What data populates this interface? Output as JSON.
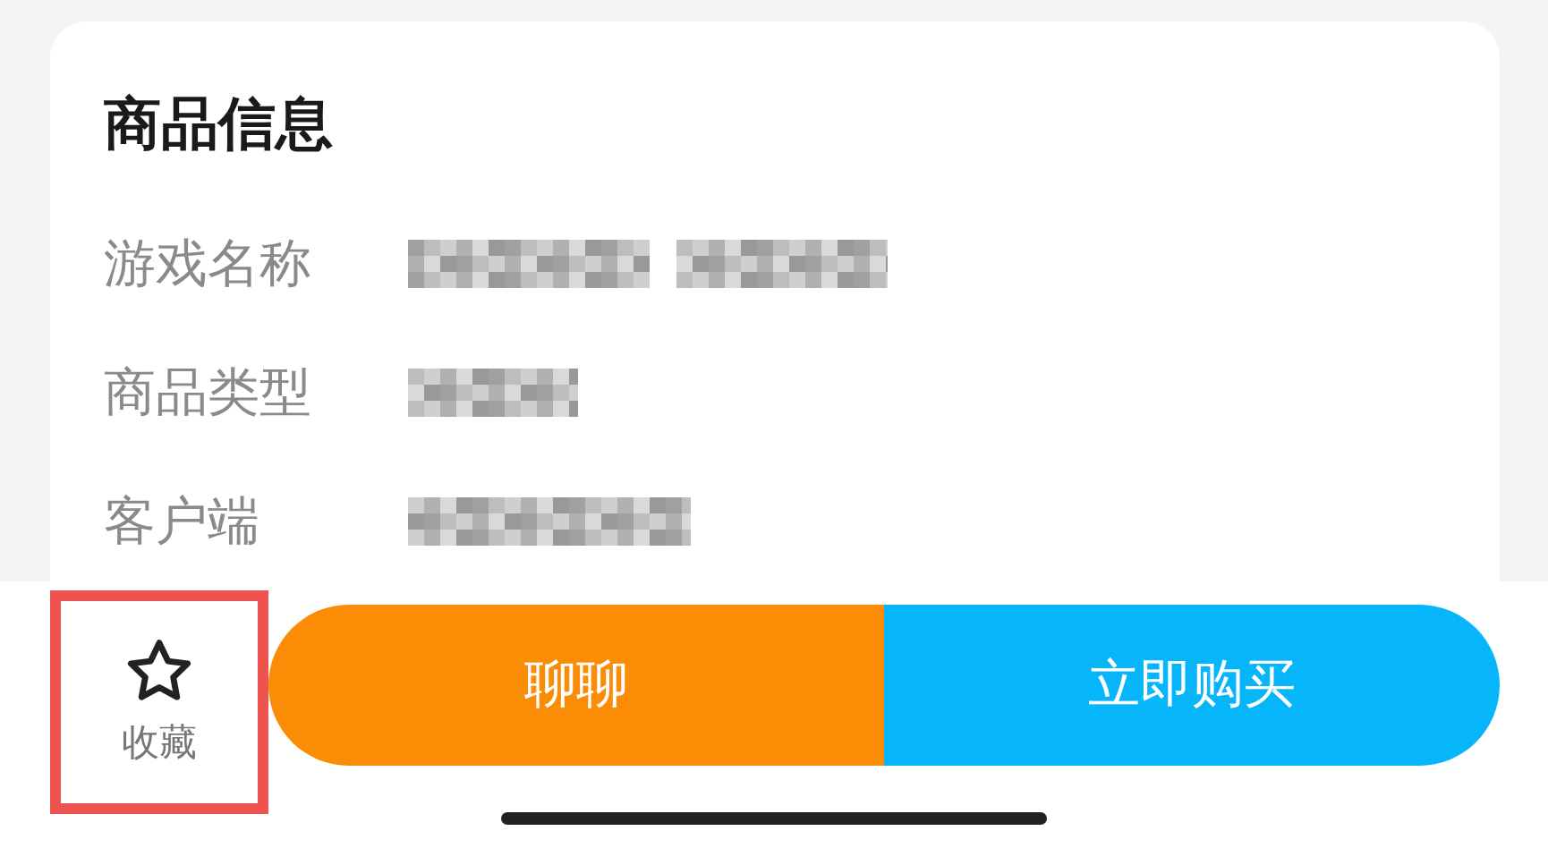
{
  "section": {
    "title": "商品信息",
    "fields": [
      {
        "label": "游戏名称"
      },
      {
        "label": "商品类型"
      },
      {
        "label": "客户端"
      }
    ]
  },
  "bottom_bar": {
    "favorite": {
      "label": "收藏",
      "highlighted": true
    },
    "buttons": [
      {
        "label": "聊聊",
        "kind": "chat"
      },
      {
        "label": "立即购买",
        "kind": "buy"
      }
    ]
  }
}
